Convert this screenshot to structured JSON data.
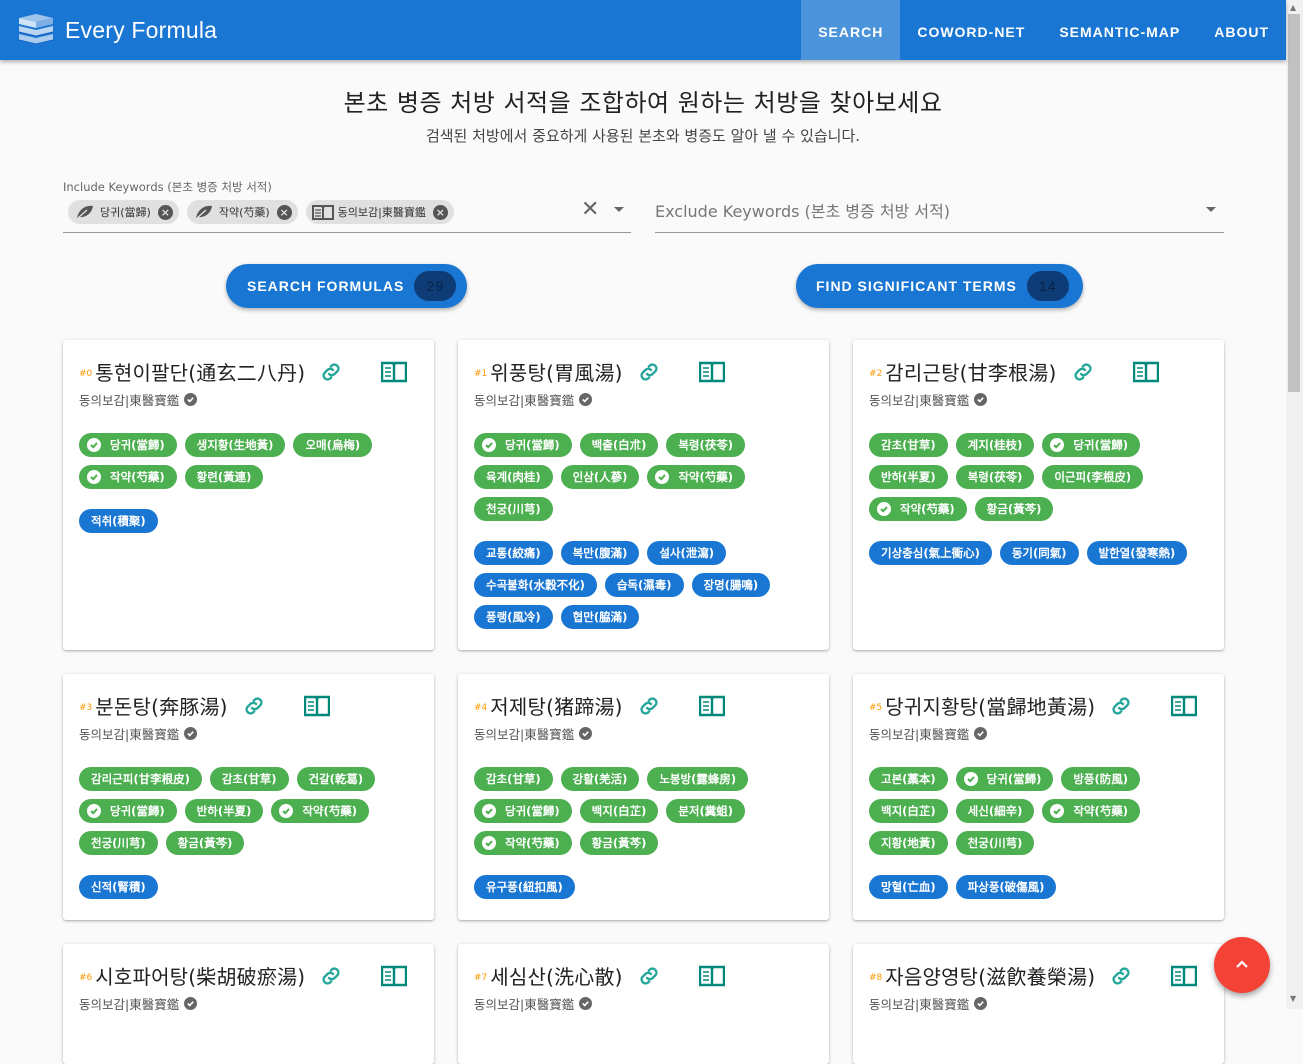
{
  "app": {
    "title": "Every Formula"
  },
  "nav": [
    {
      "label": "SEARCH",
      "active": true
    },
    {
      "label": "COWORD-NET",
      "active": false
    },
    {
      "label": "SEMANTIC-MAP",
      "active": false
    },
    {
      "label": "ABOUT",
      "active": false
    }
  ],
  "hero": {
    "headline": "본초 병증 처방 서적을 조합하여 원하는 처방을 찾아보세요",
    "subline": "검색된 처방에서 중요하게 사용된 본초와 병증도 알아 낼 수 있습니다."
  },
  "include": {
    "label": "Include Keywords (본초 병증 처방 서적)",
    "chips": [
      {
        "label": "당귀(當歸)",
        "icon": "leaf-icon"
      },
      {
        "label": "작약(芍藥)",
        "icon": "leaf-icon"
      },
      {
        "label": "동의보감|東醫寶鑑",
        "icon": "book-icon"
      }
    ]
  },
  "exclude": {
    "placeholder": "Exclude Keywords (본초 병증 처방 서적)"
  },
  "actions": {
    "search_label": "SEARCH FORMULAS",
    "search_count": "29",
    "terms_label": "FIND SIGNIFICANT TERMS",
    "terms_count": "14"
  },
  "colors": {
    "primary": "#1976d2",
    "herb": "#4caf50",
    "symptom": "#1976d2",
    "fab": "#f44336",
    "index": "#ff9800"
  },
  "cards": [
    {
      "index": "#0",
      "title": "통현이팔단(通玄二八丹)",
      "source": "동의보감|東醫寶鑑",
      "herbs": [
        {
          "label": "당귀(當歸)",
          "checked": true
        },
        {
          "label": "생지황(生地黃)",
          "checked": false
        },
        {
          "label": "오매(烏梅)",
          "checked": false
        },
        {
          "label": "작약(芍藥)",
          "checked": true
        },
        {
          "label": "황련(黃連)",
          "checked": false
        }
      ],
      "symptoms": [
        "적취(積聚)"
      ]
    },
    {
      "index": "#1",
      "title": "위풍탕(胃風湯)",
      "source": "동의보감|東醫寶鑑",
      "herbs": [
        {
          "label": "당귀(當歸)",
          "checked": true
        },
        {
          "label": "백출(白朮)",
          "checked": false
        },
        {
          "label": "복령(茯苓)",
          "checked": false
        },
        {
          "label": "육계(肉桂)",
          "checked": false
        },
        {
          "label": "인삼(人蔘)",
          "checked": false
        },
        {
          "label": "작약(芍藥)",
          "checked": true
        },
        {
          "label": "천궁(川芎)",
          "checked": false
        }
      ],
      "symptoms": [
        "교통(絞痛)",
        "복만(腹滿)",
        "설사(泄瀉)",
        "수곡불화(水穀不化)",
        "습독(濕毒)",
        "장명(腸鳴)",
        "풍랭(風冷)",
        "협만(脇滿)"
      ]
    },
    {
      "index": "#2",
      "title": "감리근탕(甘李根湯)",
      "source": "동의보감|東醫寶鑑",
      "herbs": [
        {
          "label": "감초(甘草)",
          "checked": false
        },
        {
          "label": "계지(桂枝)",
          "checked": false
        },
        {
          "label": "당귀(當歸)",
          "checked": true
        },
        {
          "label": "반하(半夏)",
          "checked": false
        },
        {
          "label": "복령(茯苓)",
          "checked": false
        },
        {
          "label": "이근피(李根皮)",
          "checked": false
        },
        {
          "label": "작약(芍藥)",
          "checked": true
        },
        {
          "label": "황금(黃芩)",
          "checked": false
        }
      ],
      "symptoms": [
        "기상충심(氣上衝心)",
        "동기(同氣)",
        "발한열(發寒熱)"
      ]
    },
    {
      "index": "#3",
      "title": "분돈탕(奔豚湯)",
      "source": "동의보감|東醫寶鑑",
      "herbs": [
        {
          "label": "감리근피(甘李根皮)",
          "checked": false
        },
        {
          "label": "감초(甘草)",
          "checked": false
        },
        {
          "label": "건갈(乾葛)",
          "checked": false
        },
        {
          "label": "당귀(當歸)",
          "checked": true
        },
        {
          "label": "반하(半夏)",
          "checked": false
        },
        {
          "label": "작약(芍藥)",
          "checked": true
        },
        {
          "label": "천궁(川芎)",
          "checked": false
        },
        {
          "label": "황금(黃芩)",
          "checked": false
        }
      ],
      "symptoms": [
        "신적(腎積)"
      ]
    },
    {
      "index": "#4",
      "title": "저제탕(猪蹄湯)",
      "source": "동의보감|東醫寶鑑",
      "herbs": [
        {
          "label": "감초(甘草)",
          "checked": false
        },
        {
          "label": "강활(羌活)",
          "checked": false
        },
        {
          "label": "노봉방(露蜂房)",
          "checked": false
        },
        {
          "label": "당귀(當歸)",
          "checked": true
        },
        {
          "label": "백지(白芷)",
          "checked": false
        },
        {
          "label": "분저(糞蛆)",
          "checked": false
        },
        {
          "label": "작약(芍藥)",
          "checked": true
        },
        {
          "label": "황금(黃芩)",
          "checked": false
        }
      ],
      "symptoms": [
        "유구풍(紐扣風)"
      ]
    },
    {
      "index": "#5",
      "title": "당귀지황탕(當歸地黃湯)",
      "source": "동의보감|東醫寶鑑",
      "herbs": [
        {
          "label": "고본(藁本)",
          "checked": false
        },
        {
          "label": "당귀(當歸)",
          "checked": true
        },
        {
          "label": "방풍(防風)",
          "checked": false
        },
        {
          "label": "백지(白芷)",
          "checked": false
        },
        {
          "label": "세신(細辛)",
          "checked": false
        },
        {
          "label": "작약(芍藥)",
          "checked": true
        },
        {
          "label": "지황(地黃)",
          "checked": false
        },
        {
          "label": "천궁(川芎)",
          "checked": false
        }
      ],
      "symptoms": [
        "망혈(亡血)",
        "파상풍(破傷風)"
      ]
    },
    {
      "index": "#6",
      "title": "시호파어탕(柴胡破瘀湯)",
      "source": "동의보감|東醫寶鑑",
      "herbs": [],
      "symptoms": []
    },
    {
      "index": "#7",
      "title": "세심산(洗心散)",
      "source": "동의보감|東醫寶鑑",
      "herbs": [],
      "symptoms": []
    },
    {
      "index": "#8",
      "title": "자음양영탕(滋飮養榮湯)",
      "source": "동의보감|東醫寶鑑",
      "herbs": [],
      "symptoms": []
    }
  ]
}
